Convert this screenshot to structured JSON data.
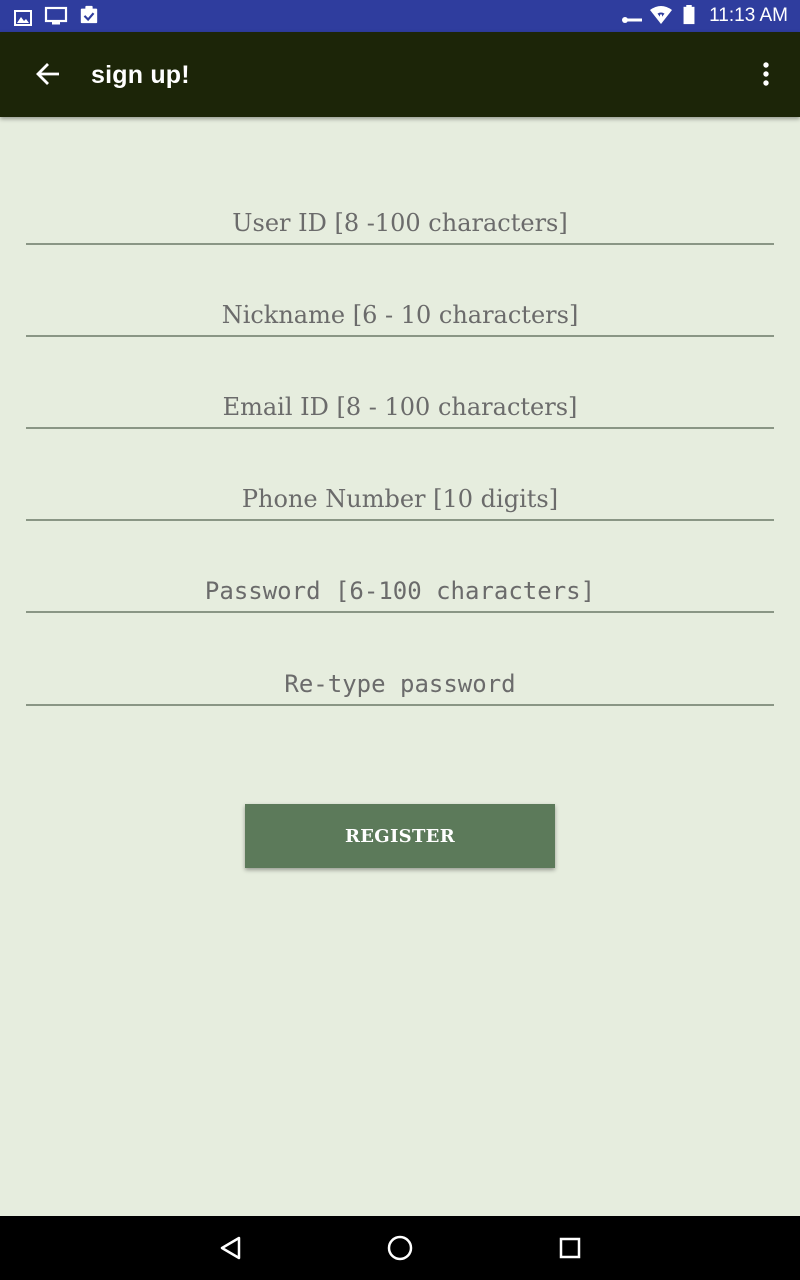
{
  "status_bar": {
    "time": "11:13 AM",
    "left_icons": [
      "image-icon",
      "monitor-icon",
      "clipboard-check-icon"
    ],
    "right_icons": [
      "key-icon",
      "wifi-icon",
      "battery-icon"
    ]
  },
  "toolbar": {
    "title": "sign up!",
    "back_icon": "arrow-back-icon",
    "menu_icon": "more-vert-icon"
  },
  "form": {
    "user_id": {
      "placeholder": "User ID [8 -100 characters]",
      "value": ""
    },
    "nickname": {
      "placeholder": "Nickname [6 - 10 characters]",
      "value": ""
    },
    "email": {
      "placeholder": "Email ID [8 - 100 characters]",
      "value": ""
    },
    "phone": {
      "placeholder": "Phone Number [10 digits]",
      "value": ""
    },
    "password": {
      "placeholder": "Password [6-100 characters]",
      "value": ""
    },
    "retype_password": {
      "placeholder": "Re-type password",
      "value": ""
    },
    "register_label": "REGISTER"
  },
  "nav_bar": {
    "icons": [
      "back-triangle-icon",
      "home-circle-icon",
      "recents-square-icon"
    ]
  },
  "colors": {
    "status_bar": "#2F3D9E",
    "toolbar": "#1C2508",
    "background": "#E6EDDE",
    "button": "#5C7A5A",
    "underline": "#8A9685"
  }
}
